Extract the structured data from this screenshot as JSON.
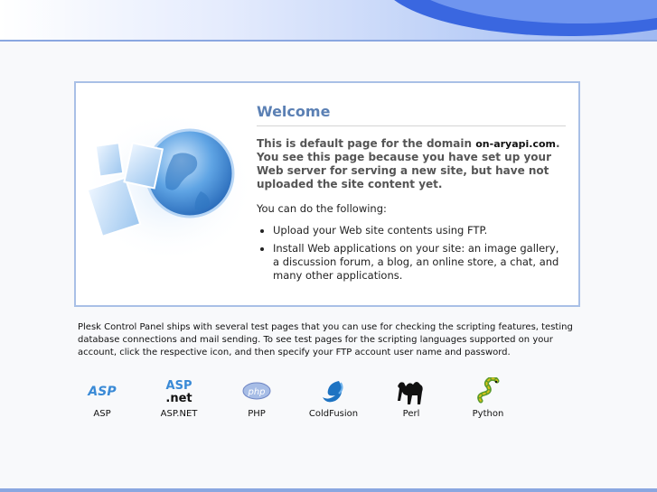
{
  "welcome": {
    "title": "Welcome",
    "intro_prefix": "This is default page for the domain ",
    "domain": "on-aryapi.com",
    "intro_suffix": ". You see this page because you have set up your Web server for serving a new site, but have not uploaded the site content yet.",
    "can_do": "You can do the following:",
    "items": [
      "Upload your Web site contents using FTP.",
      "Install Web applications on your site: an image gallery, a discussion forum, a blog, an online store, a chat, and many other applications."
    ]
  },
  "info_text": "Plesk Control Panel ships with several test pages that you can use for checking the scripting features, testing database connections and mail sending. To see test pages for the scripting languages supported on your account, click the respective icon, and then specify your FTP account user name and password.",
  "tech": [
    {
      "label": "ASP",
      "icon": "asp-icon"
    },
    {
      "label": "ASP.NET",
      "icon": "aspnet-icon"
    },
    {
      "label": "PHP",
      "icon": "php-icon"
    },
    {
      "label": "ColdFusion",
      "icon": "coldfusion-icon"
    },
    {
      "label": "Perl",
      "icon": "perl-camel-icon"
    },
    {
      "label": "Python",
      "icon": "python-snake-icon"
    }
  ],
  "icon_text": {
    "asp": "ASP",
    "aspnet_top": "ASP",
    "aspnet_bottom": ".net",
    "php": "php"
  },
  "colors": {
    "title": "#5b80b4",
    "box_border": "#a9c0e6",
    "banner_accent": "#3a67e0"
  }
}
